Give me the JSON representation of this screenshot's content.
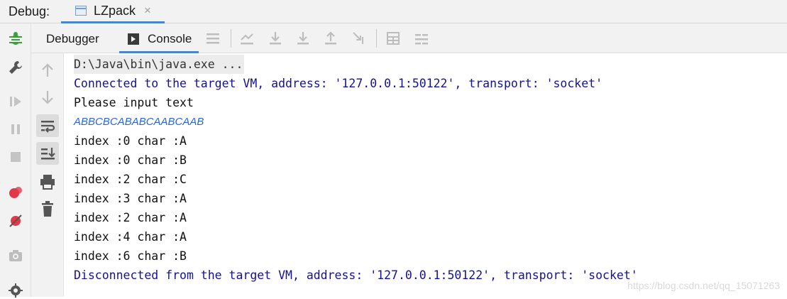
{
  "header": {
    "debug_label": "Debug:",
    "tab_label": "LZpack",
    "tab_close": "×"
  },
  "toolbar": {
    "debugger_label": "Debugger",
    "console_label": "Console"
  },
  "console": {
    "lines": [
      {
        "text": "D:\\Java\\bin\\java.exe ...",
        "kind": "cmd"
      },
      {
        "text": "Connected to the target VM, address: '127.0.0.1:50122', transport: 'socket'",
        "kind": "sys"
      },
      {
        "text": "Please input text",
        "kind": "out"
      },
      {
        "text": "ABBCBCABABCAABCAAB",
        "kind": "inp"
      },
      {
        "text": "index :0 char :A",
        "kind": "out"
      },
      {
        "text": "index :0 char :B",
        "kind": "out"
      },
      {
        "text": "index :2 char :C",
        "kind": "out"
      },
      {
        "text": "index :3 char :A",
        "kind": "out"
      },
      {
        "text": "index :2 char :A",
        "kind": "out"
      },
      {
        "text": "index :4 char :A",
        "kind": "out"
      },
      {
        "text": "index :6 char :B",
        "kind": "out"
      },
      {
        "text": "Disconnected from the target VM, address: '127.0.0.1:50122', transport: 'socket'",
        "kind": "sys"
      }
    ]
  },
  "watermark": "https://blog.csdn.net/qq_15071263",
  "colors": {
    "accent": "#4a86c7",
    "system_text": "#15128f",
    "input_text": "#2b67d0",
    "bug_green": "#3c9e3c",
    "breakpoint_red": "#e0394a"
  }
}
